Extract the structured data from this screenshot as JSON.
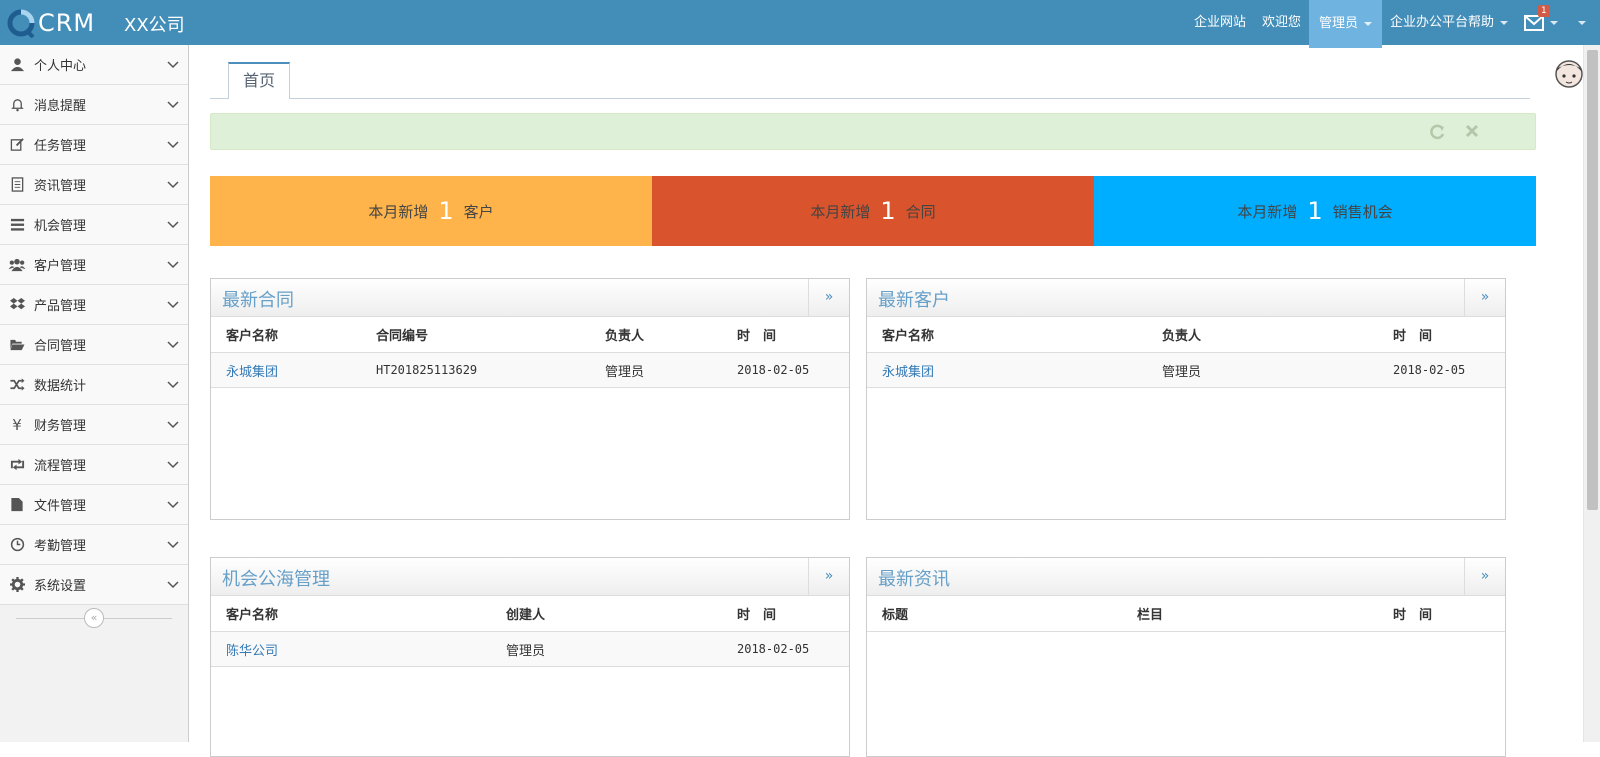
{
  "brand": {
    "logo_text": "CRM",
    "company": "XX公司"
  },
  "colors": {
    "topbar": "#438eb9",
    "orange": "#ffb44b",
    "red": "#d9532c",
    "blue": "#00aeff",
    "link": "#337ab7"
  },
  "topnav": {
    "links": [
      "企业网站",
      "欢迎您",
      "管理员",
      "企业办公平台帮助"
    ],
    "mail_badge": "1"
  },
  "sidebar": {
    "items": [
      {
        "label": "个人中心",
        "icon": "user-icon"
      },
      {
        "label": "消息提醒",
        "icon": "bell-icon"
      },
      {
        "label": "任务管理",
        "icon": "edit-icon"
      },
      {
        "label": "资讯管理",
        "icon": "document-icon"
      },
      {
        "label": "机会管理",
        "icon": "list-icon"
      },
      {
        "label": "客户管理",
        "icon": "users-icon"
      },
      {
        "label": "产品管理",
        "icon": "dropbox-icon"
      },
      {
        "label": "合同管理",
        "icon": "folder-open-icon"
      },
      {
        "label": "数据统计",
        "icon": "shuffle-icon"
      },
      {
        "label": "财务管理",
        "icon": "yen-icon"
      },
      {
        "label": "流程管理",
        "icon": "retweet-icon"
      },
      {
        "label": "文件管理",
        "icon": "file-icon"
      },
      {
        "label": "考勤管理",
        "icon": "clock-icon"
      },
      {
        "label": "系统设置",
        "icon": "gear-icon"
      }
    ],
    "collapse_symbol": "«"
  },
  "tabs": {
    "home": "首页"
  },
  "stats": [
    {
      "prefix": "本月新增",
      "value": "1",
      "suffix": "客户"
    },
    {
      "prefix": "本月新增",
      "value": "1",
      "suffix": "合同"
    },
    {
      "prefix": "本月新增",
      "value": "1",
      "suffix": "销售机会"
    }
  ],
  "panels": {
    "contracts": {
      "title": "最新合同",
      "more": "»",
      "columns": [
        "客户名称",
        "合同编号",
        "负责人",
        "时　间"
      ],
      "rows": [
        [
          "永城集团",
          "HT201825113629",
          "管理员",
          "2018-02-05"
        ]
      ]
    },
    "customers": {
      "title": "最新客户",
      "more": "»",
      "columns": [
        "客户名称",
        "负责人",
        "时　间"
      ],
      "rows": [
        [
          "永城集团",
          "管理员",
          "2018-02-05"
        ]
      ]
    },
    "opportunities": {
      "title": "机会公海管理",
      "more": "»",
      "columns": [
        "客户名称",
        "创建人",
        "时　间"
      ],
      "rows": [
        [
          "陈华公司",
          "管理员",
          "2018-02-05"
        ]
      ]
    },
    "news": {
      "title": "最新资讯",
      "more": "»",
      "columns": [
        "标题",
        "栏目",
        "时　间"
      ],
      "rows": []
    }
  }
}
